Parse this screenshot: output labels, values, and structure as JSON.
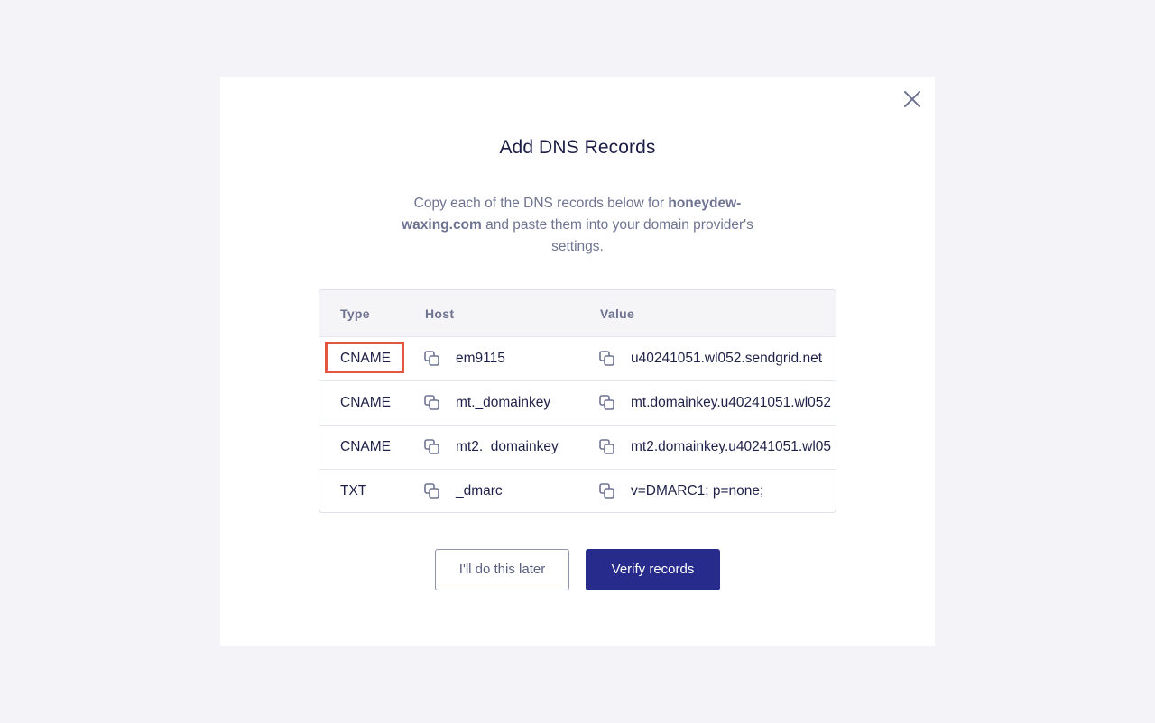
{
  "modal": {
    "title": "Add DNS Records",
    "subtitle_prefix": "Copy each of the DNS records below for ",
    "domain": "honeydew-waxing.com",
    "subtitle_suffix": " and paste them into your domain provider's settings."
  },
  "table": {
    "headers": {
      "type": "Type",
      "host": "Host",
      "value": "Value"
    },
    "rows": [
      {
        "type": "CNAME",
        "host": "em9115",
        "value": "u40241051.wl052.sendgrid.net"
      },
      {
        "type": "CNAME",
        "host": "mt._domainkey",
        "value": "mt.domainkey.u40241051.wl052"
      },
      {
        "type": "CNAME",
        "host": "mt2._domainkey",
        "value": "mt2.domainkey.u40241051.wl05"
      },
      {
        "type": "TXT",
        "host": "_dmarc",
        "value": "v=DMARC1; p=none;"
      }
    ]
  },
  "buttons": {
    "later": "I'll do this later",
    "verify": "Verify records"
  },
  "icons": {
    "close": "close-icon",
    "copy": "copy-icon"
  },
  "colors": {
    "primary": "#262b8c",
    "highlight": "#e2573d",
    "background": "#f3f3f8"
  }
}
